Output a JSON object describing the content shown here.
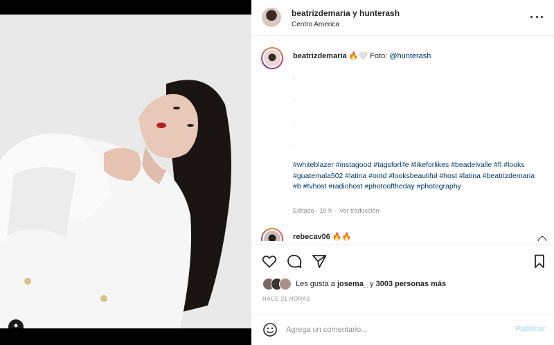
{
  "header": {
    "title": "beatrizdemaria y hunterash",
    "location": "Centro America"
  },
  "caption": {
    "username": "beatrizdemaria",
    "emoji": "🔥🤍",
    "foto_label": "Foto:",
    "mention": "@hunterash",
    "dots": [
      ".",
      ".",
      ".",
      "."
    ],
    "hashtags": "#whiteblazer #instagood #tagsforlife #likeforlikes #beadelvalle #fl #looks #guatemala502 #latina #ootd #looksbeautiful #host #latina #beatrizdemaria #b #tvhost #radiohost #photooftheday #photography",
    "edited": "Editado · 10 h",
    "translate": "Ver traducción"
  },
  "comment": {
    "username": "rebecav06",
    "text": "🔥🔥"
  },
  "likes": {
    "prefix": "Les gusta a",
    "user": "josema_",
    "middle": "y",
    "count": "3003 personas más"
  },
  "timestamp": "HACE 21 HORAS",
  "comment_box": {
    "placeholder": "Agrega un comentario...",
    "publish": "Publicar"
  },
  "icons": {
    "more": "more-options-icon",
    "like": "heart-icon",
    "comment": "comment-bubble-icon",
    "share": "paper-plane-icon",
    "save": "bookmark-icon",
    "emoji": "emoji-icon",
    "user_tag": "user-tag-icon"
  },
  "colors": {
    "link": "#00376b",
    "muted": "#8e8e8e",
    "text": "#262626",
    "publish_disabled": "#b2dffc"
  }
}
